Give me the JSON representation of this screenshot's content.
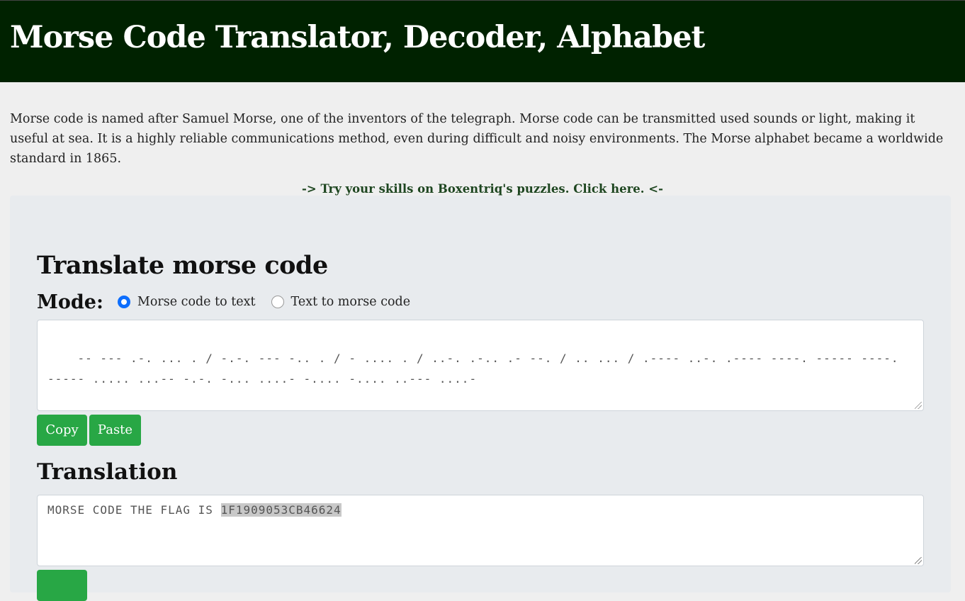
{
  "header": {
    "title": "Morse Code Translator, Decoder, Alphabet"
  },
  "intro": {
    "text": "Morse code is named after Samuel Morse, one of the inventors of the telegraph. Morse code can be transmitted used sounds or light, making it useful at sea. It is a highly reliable communications method, even during difficult and noisy environments. The Morse alphabet became a worldwide standard in 1865."
  },
  "promo": {
    "link_text": "-> Try your skills on Boxentriq's puzzles. Click here. <-"
  },
  "translator": {
    "title": "Translate morse code",
    "mode_label": "Mode:",
    "modes": [
      {
        "label": "Morse code to text",
        "checked": true
      },
      {
        "label": "Text to morse code",
        "checked": false
      }
    ],
    "input_value": "-- --- .-. ... . / -.-. --- -.. . / - .... . / ..-. .-.. .- --. / .. ... / .---- ..-. .---- ----. ----- ----. ----- ..... ...-- -.-. -... ....- -.... -.... ..--- ....-",
    "copy_label": "Copy",
    "paste_label": "Paste",
    "translation_title": "Translation",
    "output_prefix": "MORSE CODE THE FLAG IS ",
    "output_selected": "1F1909053CB46624"
  },
  "colors": {
    "header_bg": "#002200",
    "button_green": "#28a745",
    "radio_blue": "#0d6efd",
    "link_green": "#1e4620"
  }
}
